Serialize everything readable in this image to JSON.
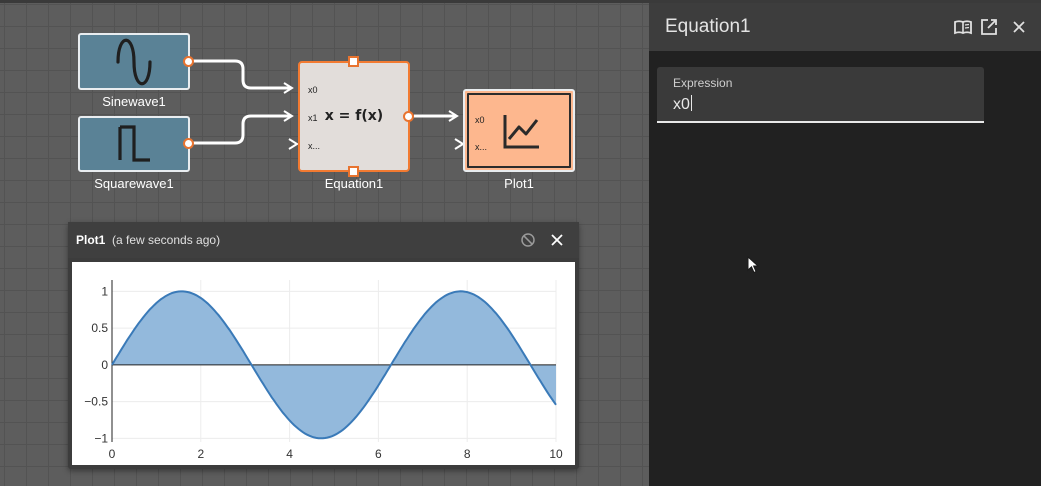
{
  "canvas": {
    "blocks": {
      "sinewave": {
        "label": "Sinewave1",
        "icon": "sine-wave-icon"
      },
      "squarewave": {
        "label": "Squarewave1",
        "icon": "square-wave-icon"
      },
      "equation": {
        "label": "Equation1",
        "formula": "x = f(x)",
        "ports": [
          "x0",
          "x1",
          "x..."
        ]
      },
      "plot": {
        "label": "Plot1",
        "ports": [
          "x0",
          "x..."
        ],
        "icon": "line-chart-icon"
      }
    }
  },
  "plot_window": {
    "title": "Plot1",
    "timestamp": "(a few seconds ago)",
    "icons": [
      "disable-icon",
      "close-icon"
    ]
  },
  "properties": {
    "title": "Equation1",
    "icons": [
      "docs-book-icon",
      "open-external-icon",
      "close-icon"
    ],
    "expression": {
      "label": "Expression",
      "value": "x0"
    }
  },
  "colors": {
    "canvas_bg": "#5d5d5d",
    "source_block": "#5a8296",
    "equation_block": "#e2ddda",
    "plot_block": "#fdb78e",
    "accent_orange": "#f27a31",
    "panel_bg": "#212121",
    "chart_line": "#3a7ab8",
    "chart_fill": "#93b9dc"
  },
  "chart_data": {
    "type": "area",
    "title": "",
    "xlabel": "",
    "ylabel": "",
    "series": [
      {
        "function": "y = sin(x)",
        "x": [
          0,
          0.5,
          1,
          1.5,
          2,
          2.5,
          3,
          3.5,
          4,
          4.5,
          5,
          5.5,
          6,
          6.5,
          7,
          7.5,
          8,
          8.5,
          9,
          9.5,
          10
        ],
        "y": [
          0,
          0.479,
          0.841,
          0.997,
          0.909,
          0.598,
          0.141,
          -0.351,
          -0.757,
          -0.978,
          -0.959,
          -0.706,
          -0.279,
          0.215,
          0.657,
          0.938,
          0.989,
          0.798,
          0.412,
          -0.075,
          -0.544
        ]
      }
    ],
    "xlim": [
      0,
      10
    ],
    "ylim": [
      -1.05,
      1.1
    ],
    "xticks": [
      "0",
      "2",
      "4",
      "6",
      "8",
      "10"
    ],
    "yticks": [
      "1",
      "0.5",
      "0",
      "−0.5",
      "−1"
    ],
    "grid": true
  }
}
